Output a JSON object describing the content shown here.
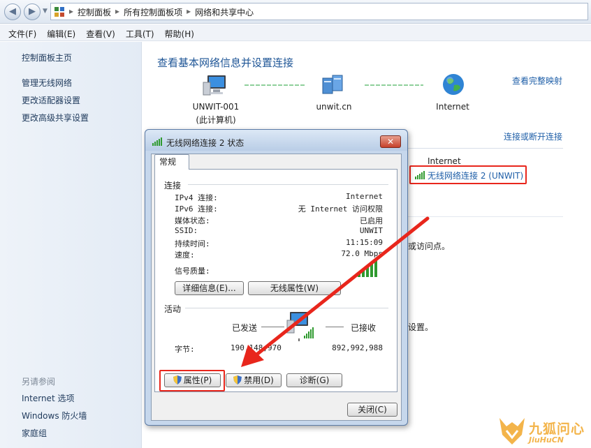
{
  "breadcrumb": [
    "控制面板",
    "所有控制面板项",
    "网络和共享中心"
  ],
  "menu": [
    "文件(F)",
    "编辑(E)",
    "查看(V)",
    "工具(T)",
    "帮助(H)"
  ],
  "sidebar": {
    "home": "控制面板主页",
    "links": [
      "管理无线网络",
      "更改适配器设置",
      "更改高级共享设置"
    ],
    "see_also_header": "另请参阅",
    "see_also": [
      "Internet 选项",
      "Windows 防火墙",
      "家庭组"
    ]
  },
  "main": {
    "title": "查看基本网络信息并设置连接",
    "view_full_map": "查看完整映射",
    "connect_disconnect": "连接或断开连接",
    "nodes": [
      {
        "name": "UNWIT-001",
        "sub": "(此计算机)",
        "icon": "computer-icon"
      },
      {
        "name": "unwit.cn",
        "sub": "",
        "icon": "network-icon"
      },
      {
        "name": "Internet",
        "sub": "",
        "icon": "globe-icon"
      }
    ],
    "access_type_value": "Internet",
    "connection_link": "无线网络连接 2 (UNWIT)",
    "snippet_1": "或访问点。",
    "snippet_2": "设置。"
  },
  "dialog": {
    "title": "无线网络连接 2 状态",
    "close": "✕",
    "tab": "常规",
    "connection_group": "连接",
    "rows": [
      {
        "key": "IPv4 连接:",
        "value": "Internet"
      },
      {
        "key": "IPv6 连接:",
        "value": "无 Internet 访问权限"
      },
      {
        "key": "媒体状态:",
        "value": "已启用"
      },
      {
        "key": "SSID:",
        "value": "UNWIT"
      },
      {
        "key": "持续时间:",
        "value": "11:15:09"
      },
      {
        "key": "速度:",
        "value": "72.0 Mbps"
      }
    ],
    "signal_label": "信号质量:",
    "signal_bars": 5,
    "details_button": "详细信息(E)...",
    "wireless_props_button": "无线属性(W)",
    "activity_group": "活动",
    "sent_label": "已发送",
    "received_label": "已接收",
    "bytes_label": "字节:",
    "bytes_sent": "190,148,970",
    "bytes_received": "892,992,988",
    "properties_button": "属性(P)",
    "disable_button": "禁用(D)",
    "diagnose_button": "诊断(G)",
    "close_button": "关闭(C)"
  },
  "watermark": {
    "text": "九狐问心",
    "sub": "JiuHuCN"
  },
  "colors": {
    "link": "#1f5fa8",
    "highlight": "#e8261c",
    "signal": "#2f9a2f"
  }
}
